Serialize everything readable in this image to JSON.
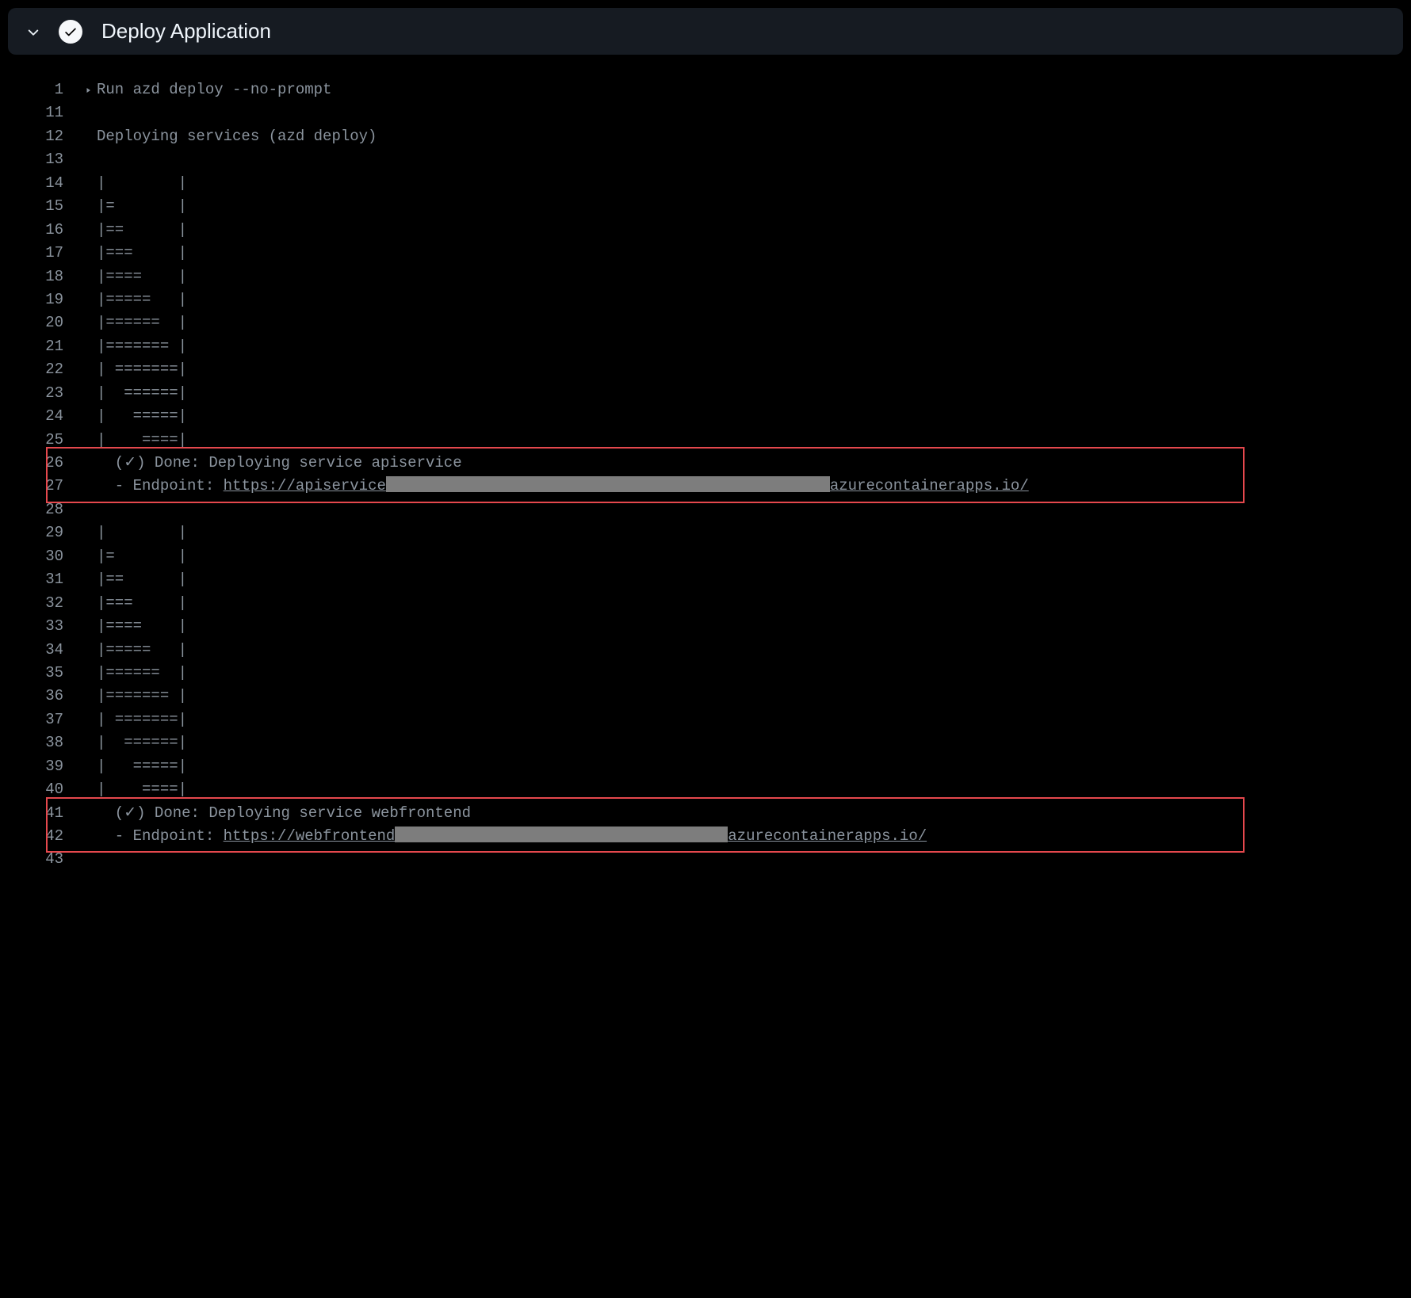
{
  "header": {
    "title": "Deploy Application"
  },
  "lines": [
    {
      "no": "1",
      "foldable": true,
      "type": "text",
      "text": "Run azd deploy --no-prompt"
    },
    {
      "no": "11",
      "type": "text",
      "text": ""
    },
    {
      "no": "12",
      "type": "text",
      "text": "Deploying services (azd deploy)"
    },
    {
      "no": "13",
      "type": "text",
      "text": ""
    },
    {
      "no": "14",
      "type": "text",
      "text": "|        |"
    },
    {
      "no": "15",
      "type": "text",
      "text": "|=       |"
    },
    {
      "no": "16",
      "type": "text",
      "text": "|==      |"
    },
    {
      "no": "17",
      "type": "text",
      "text": "|===     |"
    },
    {
      "no": "18",
      "type": "text",
      "text": "|====    |"
    },
    {
      "no": "19",
      "type": "text",
      "text": "|=====   |"
    },
    {
      "no": "20",
      "type": "text",
      "text": "|======  |"
    },
    {
      "no": "21",
      "type": "text",
      "text": "|======= |"
    },
    {
      "no": "22",
      "type": "text",
      "text": "| =======|"
    },
    {
      "no": "23",
      "type": "text",
      "text": "|  ======|"
    },
    {
      "no": "24",
      "type": "text",
      "text": "|   =====|"
    },
    {
      "no": "25",
      "type": "text",
      "text": "|    ====|"
    },
    {
      "no": "26",
      "type": "text",
      "text": "  (✓) Done: Deploying service apiservice"
    },
    {
      "no": "27",
      "type": "endpoint",
      "prefix": "  - Endpoint: ",
      "link_pre": "https://apiservice",
      "redact_width": 560,
      "link_post": "azurecontainerapps.io/"
    },
    {
      "no": "28",
      "type": "text",
      "text": ""
    },
    {
      "no": "29",
      "type": "text",
      "text": "|        |"
    },
    {
      "no": "30",
      "type": "text",
      "text": "|=       |"
    },
    {
      "no": "31",
      "type": "text",
      "text": "|==      |"
    },
    {
      "no": "32",
      "type": "text",
      "text": "|===     |"
    },
    {
      "no": "33",
      "type": "text",
      "text": "|====    |"
    },
    {
      "no": "34",
      "type": "text",
      "text": "|=====   |"
    },
    {
      "no": "35",
      "type": "text",
      "text": "|======  |"
    },
    {
      "no": "36",
      "type": "text",
      "text": "|======= |"
    },
    {
      "no": "37",
      "type": "text",
      "text": "| =======|"
    },
    {
      "no": "38",
      "type": "text",
      "text": "|  ======|"
    },
    {
      "no": "39",
      "type": "text",
      "text": "|   =====|"
    },
    {
      "no": "40",
      "type": "text",
      "text": "|    ====|"
    },
    {
      "no": "41",
      "type": "text",
      "text": "  (✓) Done: Deploying service webfrontend"
    },
    {
      "no": "42",
      "type": "endpoint",
      "prefix": "  - Endpoint: ",
      "link_pre": "https://webfrontend",
      "redact_width": 420,
      "link_post": "azurecontainerapps.io/"
    },
    {
      "no": "43",
      "type": "text",
      "text": ""
    }
  ],
  "highlights": [
    {
      "start": "26",
      "end": "27"
    },
    {
      "start": "41",
      "end": "42"
    }
  ]
}
